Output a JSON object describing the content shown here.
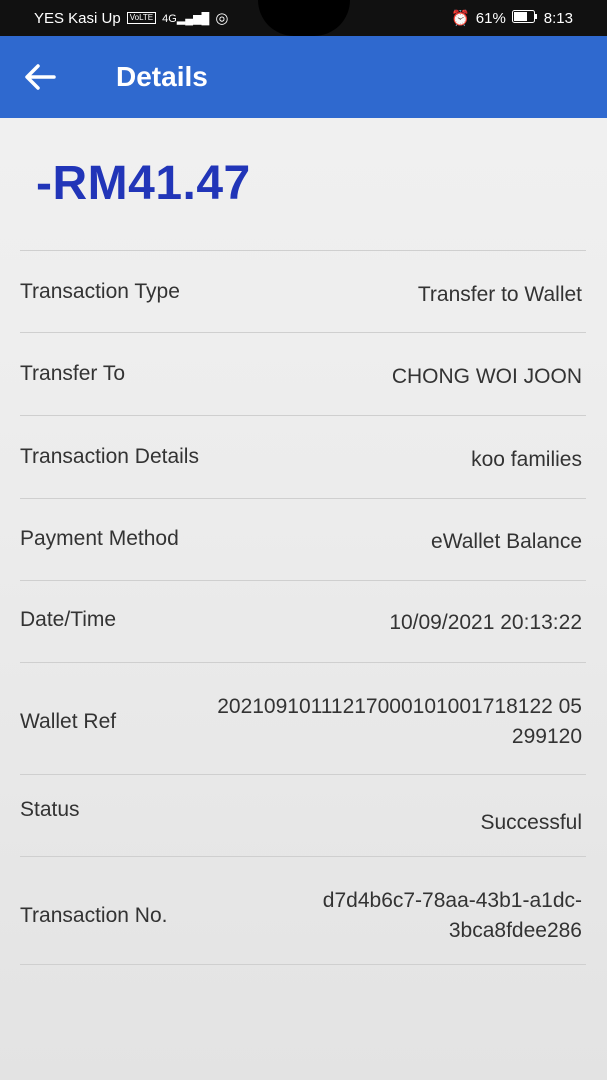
{
  "status_bar": {
    "carrier": "YES Kasi Up",
    "volte": "VoLTE",
    "signal_text": "4G",
    "battery_percent": "61%",
    "time": "8:13"
  },
  "header": {
    "title": "Details",
    "back_icon": "arrow-left-icon"
  },
  "transaction": {
    "amount": "-RM41.47",
    "rows": [
      {
        "label": "Transaction Type",
        "value": "Transfer to Wallet"
      },
      {
        "label": "Transfer To",
        "value": "CHONG WOI JOON"
      },
      {
        "label": "Transaction Details",
        "value": "koo families"
      },
      {
        "label": "Payment Method",
        "value": "eWallet Balance"
      },
      {
        "label": "Date/Time",
        "value": "10/09/2021 20:13:22"
      },
      {
        "label": "Wallet Ref",
        "value": "20210910111217000101001718122 05\n299120"
      },
      {
        "label": "Status",
        "value": "Successful"
      },
      {
        "label": "Transaction No.",
        "value": "d7d4b6c7-78aa-43b1-a1dc-\n3bca8fdee286"
      }
    ]
  },
  "colors": {
    "header_bg": "#2f69cf",
    "amount": "#2135b8"
  }
}
